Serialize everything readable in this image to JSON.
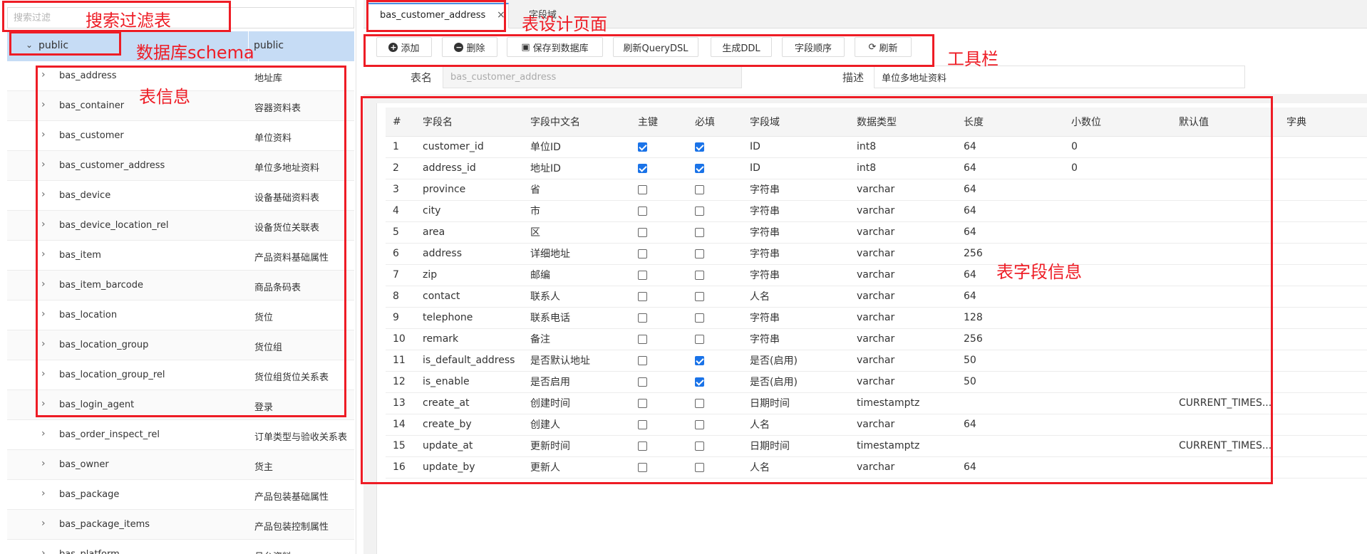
{
  "search": {
    "placeholder": "搜索过滤"
  },
  "tree": {
    "schema": {
      "name": "public",
      "desc": "public"
    },
    "tables": [
      {
        "name": "bas_address",
        "desc": "地址库"
      },
      {
        "name": "bas_container",
        "desc": "容器资料表"
      },
      {
        "name": "bas_customer",
        "desc": "单位资料"
      },
      {
        "name": "bas_customer_address",
        "desc": "单位多地址资料"
      },
      {
        "name": "bas_device",
        "desc": "设备基础资料表"
      },
      {
        "name": "bas_device_location_rel",
        "desc": "设备货位关联表"
      },
      {
        "name": "bas_item",
        "desc": "产品资料基础属性"
      },
      {
        "name": "bas_item_barcode",
        "desc": "商品条码表"
      },
      {
        "name": "bas_location",
        "desc": "货位"
      },
      {
        "name": "bas_location_group",
        "desc": "货位组"
      },
      {
        "name": "bas_location_group_rel",
        "desc": "货位组货位关系表"
      },
      {
        "name": "bas_login_agent",
        "desc": "登录"
      },
      {
        "name": "bas_order_inspect_rel",
        "desc": "订单类型与验收关系表"
      },
      {
        "name": "bas_owner",
        "desc": "货主"
      },
      {
        "name": "bas_package",
        "desc": "产品包装基础属性"
      },
      {
        "name": "bas_package_items",
        "desc": "产品包装控制属性"
      },
      {
        "name": "bas_platform",
        "desc": "月台资料"
      }
    ]
  },
  "tabs": {
    "active": "bas_customer_address",
    "second": "字段域"
  },
  "toolbar": {
    "add": "添加",
    "delete": "删除",
    "save": "保存到数据库",
    "refresh_dsl": "刷新QueryDSL",
    "gen_ddl": "生成DDL",
    "field_order": "字段顺序",
    "refresh": "刷新"
  },
  "form": {
    "table_name_label": "表名",
    "table_name_value": "bas_customer_address",
    "desc_label": "描述",
    "desc_value": "单位多地址资料"
  },
  "grid": {
    "columns": [
      "#",
      "字段名",
      "字段中文名",
      "主键",
      "必填",
      "字段域",
      "数据类型",
      "长度",
      "小数位",
      "默认值",
      "字典"
    ],
    "rows": [
      {
        "no": "1",
        "name": "customer_id",
        "cn": "单位ID",
        "pk": true,
        "req": true,
        "domain": "ID",
        "type": "int8",
        "len": "64",
        "scale": "0",
        "def": "",
        "dict": ""
      },
      {
        "no": "2",
        "name": "address_id",
        "cn": "地址ID",
        "pk": true,
        "req": true,
        "domain": "ID",
        "type": "int8",
        "len": "64",
        "scale": "0",
        "def": "",
        "dict": ""
      },
      {
        "no": "3",
        "name": "province",
        "cn": "省",
        "pk": false,
        "req": false,
        "domain": "字符串",
        "type": "varchar",
        "len": "64",
        "scale": "",
        "def": "",
        "dict": ""
      },
      {
        "no": "4",
        "name": "city",
        "cn": "市",
        "pk": false,
        "req": false,
        "domain": "字符串",
        "type": "varchar",
        "len": "64",
        "scale": "",
        "def": "",
        "dict": ""
      },
      {
        "no": "5",
        "name": "area",
        "cn": "区",
        "pk": false,
        "req": false,
        "domain": "字符串",
        "type": "varchar",
        "len": "64",
        "scale": "",
        "def": "",
        "dict": ""
      },
      {
        "no": "6",
        "name": "address",
        "cn": "详细地址",
        "pk": false,
        "req": false,
        "domain": "字符串",
        "type": "varchar",
        "len": "256",
        "scale": "",
        "def": "",
        "dict": ""
      },
      {
        "no": "7",
        "name": "zip",
        "cn": "邮编",
        "pk": false,
        "req": false,
        "domain": "字符串",
        "type": "varchar",
        "len": "64",
        "scale": "",
        "def": "",
        "dict": ""
      },
      {
        "no": "8",
        "name": "contact",
        "cn": "联系人",
        "pk": false,
        "req": false,
        "domain": "人名",
        "type": "varchar",
        "len": "64",
        "scale": "",
        "def": "",
        "dict": ""
      },
      {
        "no": "9",
        "name": "telephone",
        "cn": "联系电话",
        "pk": false,
        "req": false,
        "domain": "字符串",
        "type": "varchar",
        "len": "128",
        "scale": "",
        "def": "",
        "dict": ""
      },
      {
        "no": "10",
        "name": "remark",
        "cn": "备注",
        "pk": false,
        "req": false,
        "domain": "字符串",
        "type": "varchar",
        "len": "256",
        "scale": "",
        "def": "",
        "dict": ""
      },
      {
        "no": "11",
        "name": "is_default_address",
        "cn": "是否默认地址",
        "pk": false,
        "req": true,
        "domain": "是否(启用)",
        "type": "varchar",
        "len": "50",
        "scale": "",
        "def": "",
        "dict": ""
      },
      {
        "no": "12",
        "name": "is_enable",
        "cn": "是否启用",
        "pk": false,
        "req": true,
        "domain": "是否(启用)",
        "type": "varchar",
        "len": "50",
        "scale": "",
        "def": "",
        "dict": ""
      },
      {
        "no": "13",
        "name": "create_at",
        "cn": "创建时间",
        "pk": false,
        "req": false,
        "domain": "日期时间",
        "type": "timestamptz",
        "len": "",
        "scale": "",
        "def": "CURRENT_TIMES...",
        "dict": ""
      },
      {
        "no": "14",
        "name": "create_by",
        "cn": "创建人",
        "pk": false,
        "req": false,
        "domain": "人名",
        "type": "varchar",
        "len": "64",
        "scale": "",
        "def": "",
        "dict": ""
      },
      {
        "no": "15",
        "name": "update_at",
        "cn": "更新时间",
        "pk": false,
        "req": false,
        "domain": "日期时间",
        "type": "timestamptz",
        "len": "",
        "scale": "",
        "def": "CURRENT_TIMES...",
        "dict": ""
      },
      {
        "no": "16",
        "name": "update_by",
        "cn": "更新人",
        "pk": false,
        "req": false,
        "domain": "人名",
        "type": "varchar",
        "len": "64",
        "scale": "",
        "def": "",
        "dict": ""
      }
    ]
  },
  "annotations": {
    "search": "搜索过滤表",
    "schema": "数据库schema",
    "tables": "表信息",
    "tab": "表设计页面",
    "toolbar": "工具栏",
    "fields": "表字段信息"
  },
  "colors": {
    "annotation": "#ee1c25",
    "selected_row": "#c6dcf5",
    "checkbox_on": "#1a73e8"
  }
}
